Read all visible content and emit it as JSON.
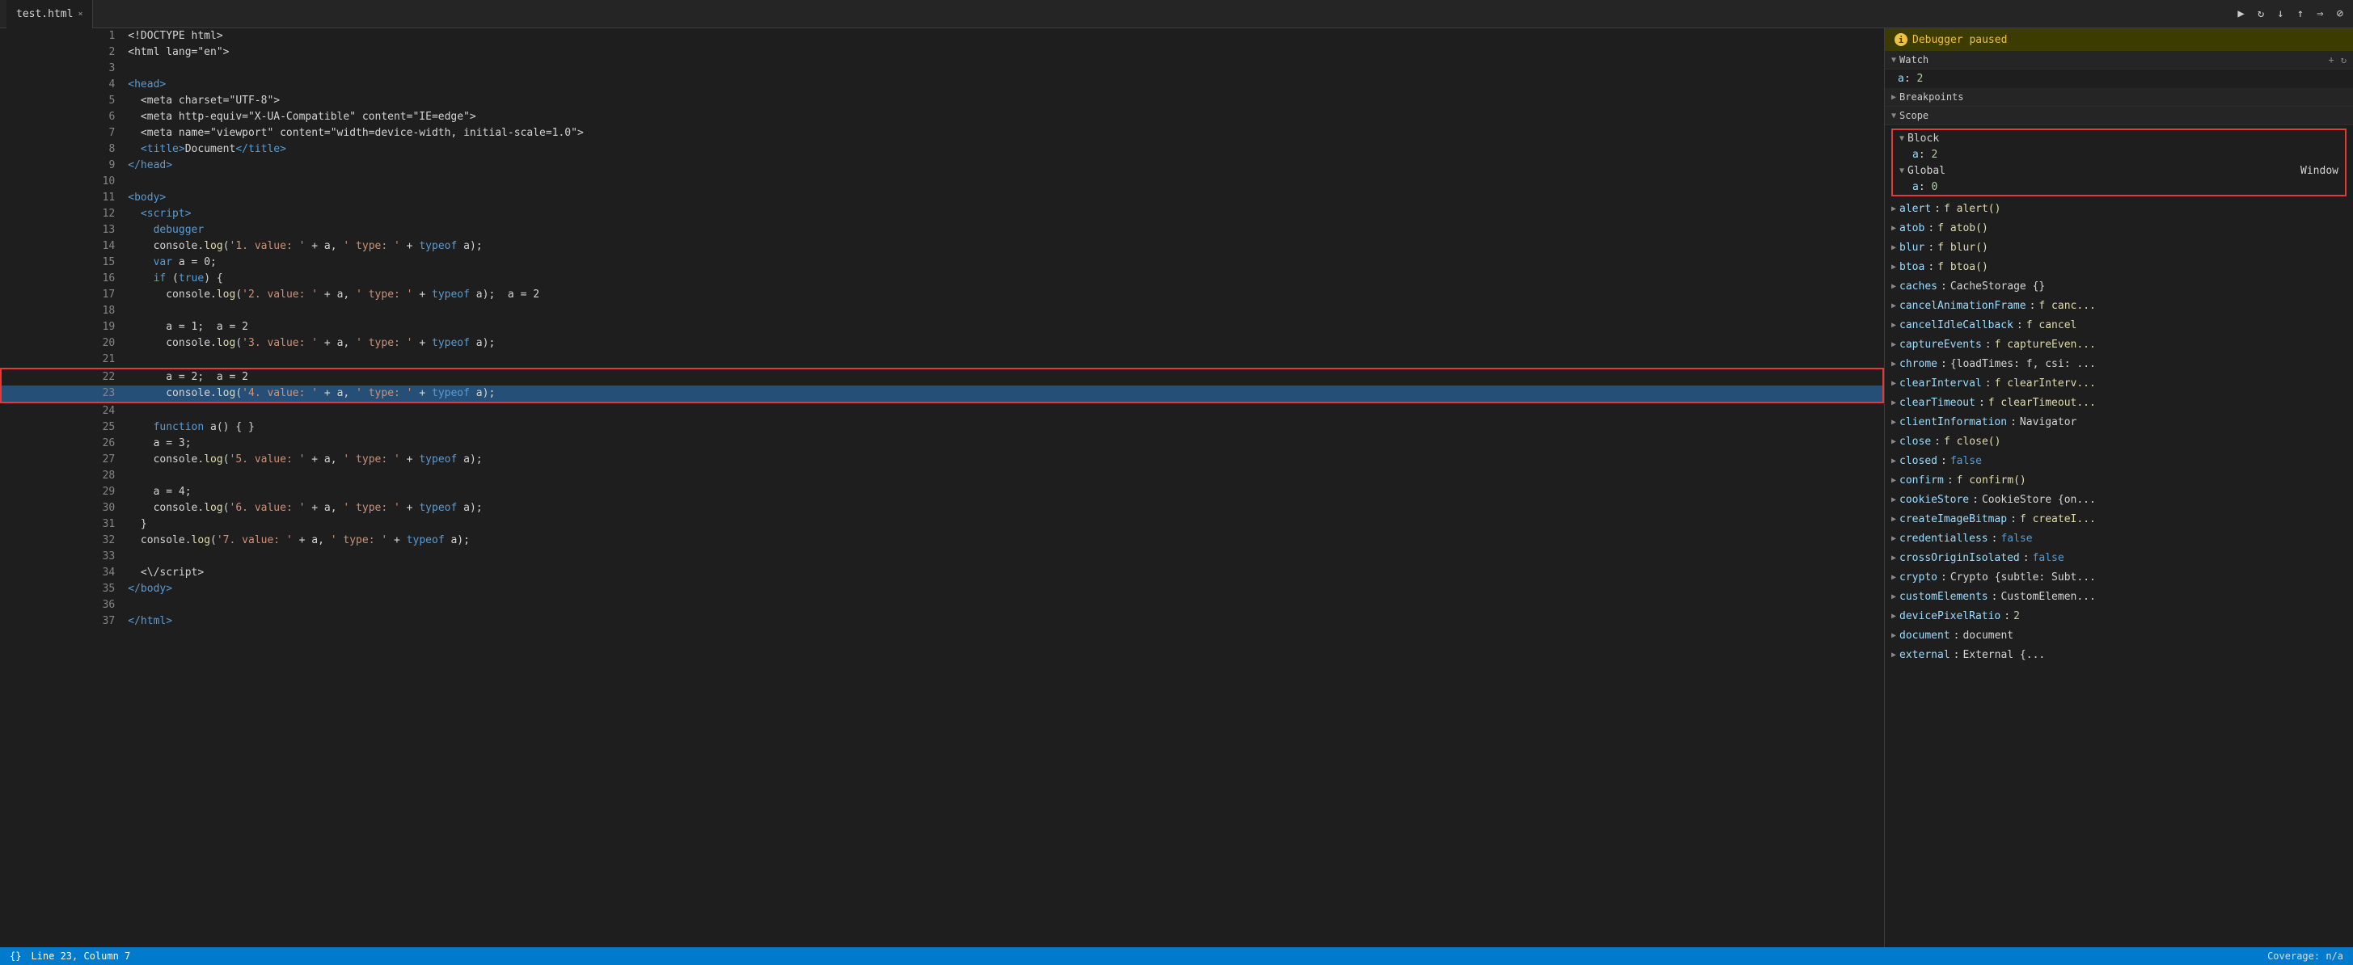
{
  "tab": {
    "name": "test.html",
    "close_label": "×"
  },
  "debugger": {
    "paused_label": "Debugger paused",
    "info_symbol": "i"
  },
  "watch": {
    "label": "Watch",
    "add_label": "+",
    "refresh_label": "↻",
    "entry_key": "a",
    "entry_value": "2"
  },
  "breakpoints": {
    "label": "Breakpoints"
  },
  "scope": {
    "label": "Scope",
    "block": {
      "label": "Block",
      "items": [
        {
          "key": "a",
          "colon": ":",
          "value": "2",
          "color": "num"
        }
      ]
    },
    "global": {
      "label": "Global",
      "right": "Window",
      "items": [
        {
          "key": "a",
          "colon": ":",
          "value": "0",
          "color": "num"
        }
      ]
    },
    "items": [
      {
        "key": "alert",
        "colon": ":",
        "value": "f alert()"
      },
      {
        "key": "atob",
        "colon": ":",
        "value": "f atob()"
      },
      {
        "key": "blur",
        "colon": ":",
        "value": "f blur()"
      },
      {
        "key": "btoa",
        "colon": ":",
        "value": "f btoa()"
      },
      {
        "key": "caches",
        "colon": ":",
        "value": "CacheStorage {}"
      },
      {
        "key": "cancelAnimationFrame",
        "colon": ":",
        "value": "f canc..."
      },
      {
        "key": "cancelIdleCallback",
        "colon": ":",
        "value": "f cancel"
      },
      {
        "key": "captureEvents",
        "colon": ":",
        "value": "f captureEven..."
      },
      {
        "key": "chrome",
        "colon": ":",
        "value": "{loadTimes: f, csi: ..."
      },
      {
        "key": "clearInterval",
        "colon": ":",
        "value": "f clearInterv..."
      },
      {
        "key": "clearTimeout",
        "colon": ":",
        "value": "f clearTimeout..."
      },
      {
        "key": "clientInformation",
        "colon": ":",
        "value": "Navigator"
      },
      {
        "key": "close",
        "colon": ":",
        "value": "f close()"
      },
      {
        "key": "closed",
        "colon": ":",
        "value": "false"
      },
      {
        "key": "confirm",
        "colon": ":",
        "value": "f confirm()"
      },
      {
        "key": "cookieStore",
        "colon": ":",
        "value": "CookieStore {on..."
      },
      {
        "key": "createImageBitmap",
        "colon": ":",
        "value": "f createI..."
      },
      {
        "key": "credentialless",
        "colon": ":",
        "value": "false"
      },
      {
        "key": "crossOriginIsolated",
        "colon": ":",
        "value": "false"
      },
      {
        "key": "crypto",
        "colon": ":",
        "value": "Crypto {subtle: Subt..."
      },
      {
        "key": "customElements",
        "colon": ":",
        "value": "CustomElemen..."
      },
      {
        "key": "devicePixelRatio",
        "colon": ":",
        "value": "2"
      },
      {
        "key": "document",
        "colon": ":",
        "value": "document"
      },
      {
        "key": "external",
        "colon": ":",
        "value": "External {..."
      }
    ]
  },
  "code_lines": [
    {
      "num": "1",
      "content": "<!DOCTYPE html>",
      "highlight": false
    },
    {
      "num": "2",
      "content": "<html lang=\"en\">",
      "highlight": false
    },
    {
      "num": "3",
      "content": "",
      "highlight": false
    },
    {
      "num": "4",
      "content": "<head>",
      "highlight": false
    },
    {
      "num": "5",
      "content": "  <meta charset=\"UTF-8\">",
      "highlight": false
    },
    {
      "num": "6",
      "content": "  <meta http-equiv=\"X-UA-Compatible\" content=\"IE=edge\">",
      "highlight": false
    },
    {
      "num": "7",
      "content": "  <meta name=\"viewport\" content=\"width=device-width, initial-scale=1.0\">",
      "highlight": false
    },
    {
      "num": "8",
      "content": "  <title>Document</title>",
      "highlight": false
    },
    {
      "num": "9",
      "content": "</head>",
      "highlight": false
    },
    {
      "num": "10",
      "content": "",
      "highlight": false
    },
    {
      "num": "11",
      "content": "<body>",
      "highlight": false
    },
    {
      "num": "12",
      "content": "  <script>",
      "highlight": false
    },
    {
      "num": "13",
      "content": "    debugger",
      "highlight": false
    },
    {
      "num": "14",
      "content": "    console.log('1. value: ' + a, ' type: ' + typeof a);",
      "highlight": false
    },
    {
      "num": "15",
      "content": "    var a = 0;",
      "highlight": false
    },
    {
      "num": "16",
      "content": "    if (true) {",
      "highlight": false
    },
    {
      "num": "17",
      "content": "      console.log('2. value: ' + a, ' type: ' + typeof a);  a = 2",
      "highlight": false
    },
    {
      "num": "18",
      "content": "",
      "highlight": false
    },
    {
      "num": "19",
      "content": "      a = 1;  a = 2",
      "highlight": false
    },
    {
      "num": "20",
      "content": "      console.log('3. value: ' + a, ' type: ' + typeof a);",
      "highlight": false
    },
    {
      "num": "21",
      "content": "",
      "highlight": false
    },
    {
      "num": "22",
      "content": "      a = 2;  a = 2",
      "highlight": false,
      "redbox": true
    },
    {
      "num": "23",
      "content": "      console.log('4. value: ' + a, ' type: ' + typeof a);",
      "highlight": true,
      "redbox": true
    },
    {
      "num": "24",
      "content": "",
      "highlight": false
    },
    {
      "num": "25",
      "content": "    function a() { }",
      "highlight": false
    },
    {
      "num": "26",
      "content": "    a = 3;",
      "highlight": false
    },
    {
      "num": "27",
      "content": "    console.log('5. value: ' + a, ' type: ' + typeof a);",
      "highlight": false
    },
    {
      "num": "28",
      "content": "",
      "highlight": false
    },
    {
      "num": "29",
      "content": "    a = 4;",
      "highlight": false
    },
    {
      "num": "30",
      "content": "    console.log('6. value: ' + a, ' type: ' + typeof a);",
      "highlight": false
    },
    {
      "num": "31",
      "content": "  }",
      "highlight": false
    },
    {
      "num": "32",
      "content": "  console.log('7. value: ' + a, ' type: ' + typeof a);",
      "highlight": false
    },
    {
      "num": "33",
      "content": "",
      "highlight": false
    },
    {
      "num": "34",
      "content": "  <\\/script>",
      "highlight": false
    },
    {
      "num": "35",
      "content": "</body>",
      "highlight": false
    },
    {
      "num": "36",
      "content": "",
      "highlight": false
    },
    {
      "num": "37",
      "content": "</html>",
      "highlight": false
    }
  ],
  "status": {
    "brace_label": "{}",
    "position": "Line 23, Column 7",
    "coverage": "Coverage: n/a"
  }
}
